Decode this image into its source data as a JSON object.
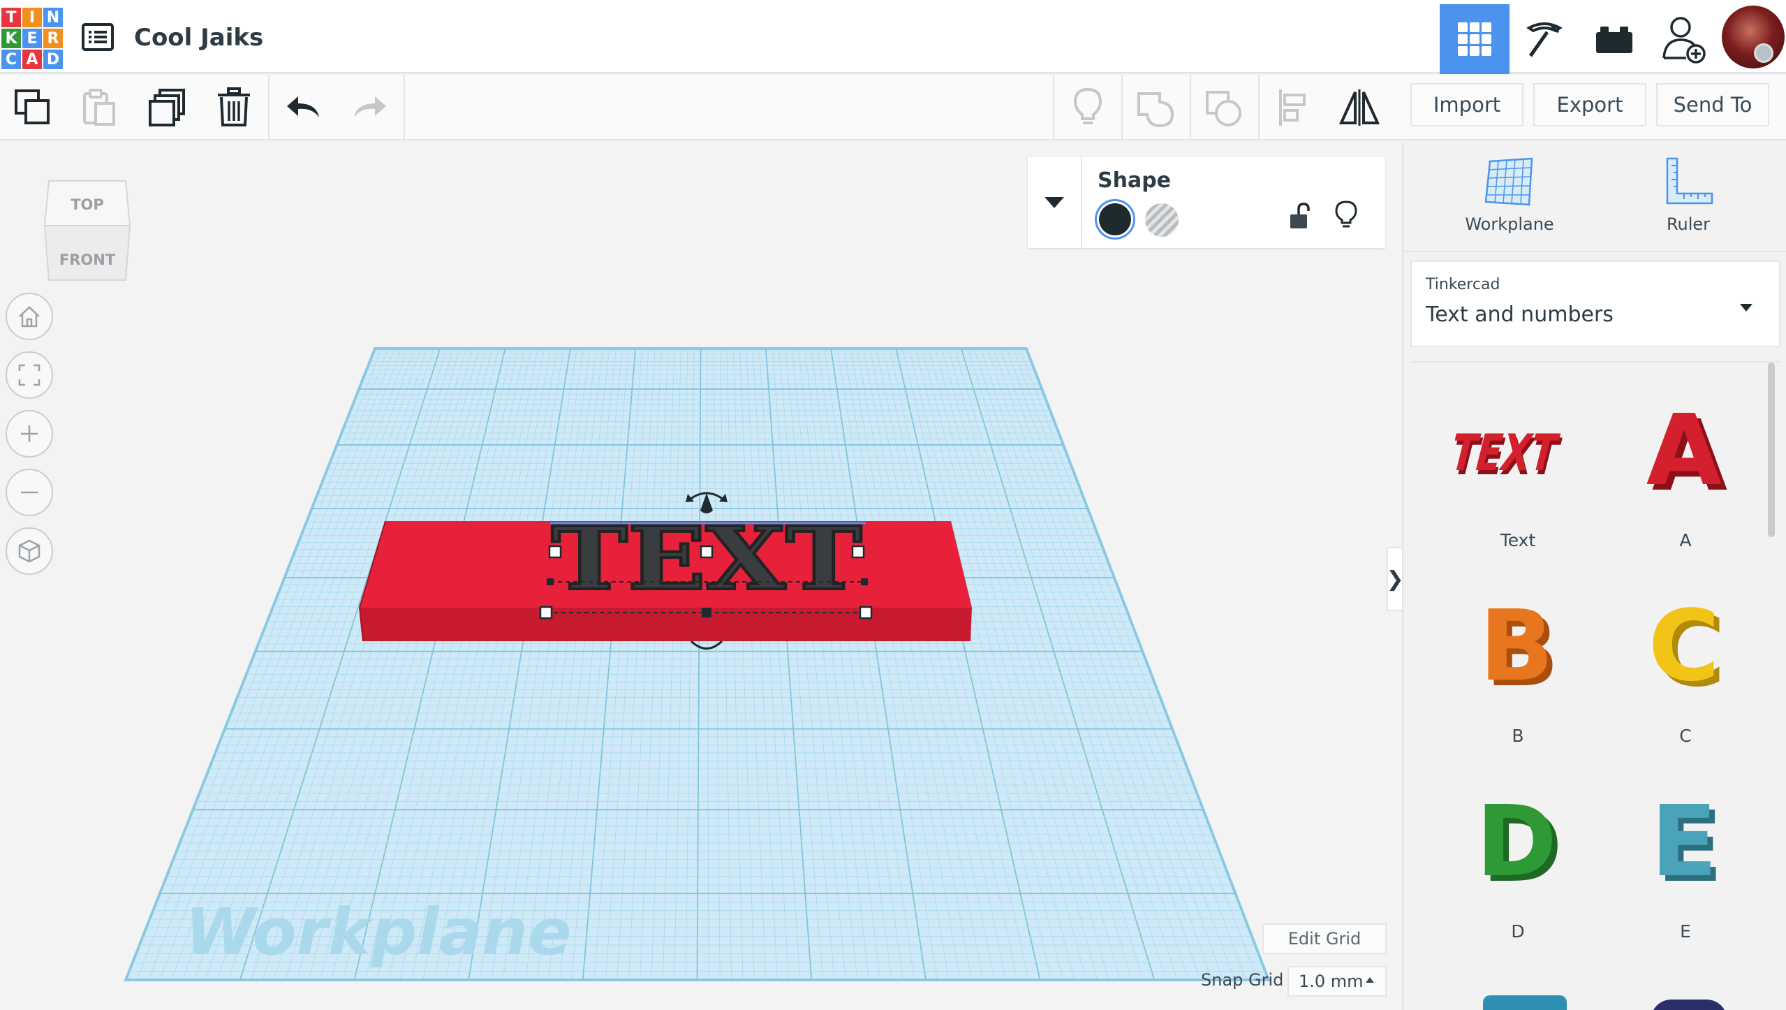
{
  "logo": {
    "letters": [
      "T",
      "I",
      "N",
      "K",
      "E",
      "R",
      "C",
      "A",
      "D"
    ]
  },
  "project": {
    "title": "Cool Jaiks"
  },
  "toolbar": {
    "import_label": "Import",
    "export_label": "Export",
    "send_to_label": "Send To"
  },
  "viewcube": {
    "top_label": "TOP",
    "front_label": "FRONT"
  },
  "inspector": {
    "title": "Shape"
  },
  "workplane": {
    "watermark": "Workplane"
  },
  "object": {
    "text": "TEXT"
  },
  "grid": {
    "edit_label": "Edit Grid",
    "snap_label": "Snap Grid",
    "snap_value": "1.0 mm"
  },
  "panel": {
    "workplane_label": "Workplane",
    "ruler_label": "Ruler",
    "library_source": "Tinkercad",
    "library_name": "Text and numbers",
    "shapes": [
      {
        "label": "Text",
        "color": "#d4202c"
      },
      {
        "label": "A",
        "color": "#d4202c"
      },
      {
        "label": "B",
        "color": "#e8761e"
      },
      {
        "label": "C",
        "color": "#f2c418"
      },
      {
        "label": "D",
        "color": "#2f9a35"
      },
      {
        "label": "E",
        "color": "#4aa3b8"
      }
    ]
  },
  "colors": {
    "accent": "#4c93f0",
    "shape_red": "#e01e2e",
    "grid": "#8fd0e8"
  }
}
